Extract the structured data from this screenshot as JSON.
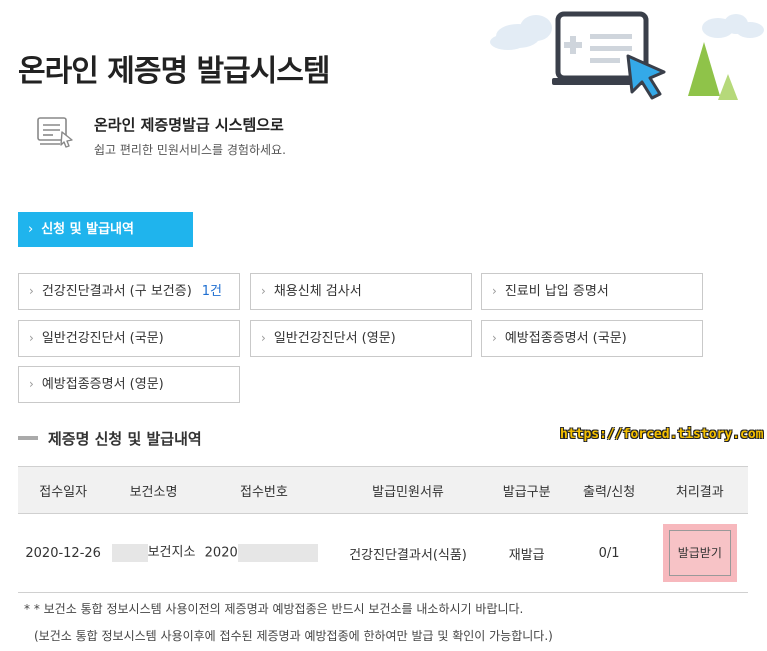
{
  "header": {
    "title": "온라인 제증명 발급시스템",
    "hero_title": "온라인 제증명발급 시스템으로",
    "hero_subtitle": "쉽고 편리한 민원서비스를 경험하세요."
  },
  "active_tab": {
    "label": "신청 및 발급내역",
    "color": "#1fb4ed"
  },
  "categories": [
    {
      "label": "건강진단결과서 (구 보건증)",
      "count": "1건"
    },
    {
      "label": "채용신체 검사서"
    },
    {
      "label": "진료비 납입 증명서"
    },
    {
      "label": "일반건강진단서 (국문)"
    },
    {
      "label": "일반건강진단서 (영문)"
    },
    {
      "label": "예방접종증명서 (국문)"
    },
    {
      "label": "예방접종증명서 (영문)"
    }
  ],
  "section": {
    "title": "제증명 신청 및 발급내역",
    "watermark": "https://forced.tistory.com"
  },
  "table": {
    "headers": [
      "접수일자",
      "보건소명",
      "접수번호",
      "발급민원서류",
      "발급구분",
      "출력/신청",
      "처리결과"
    ],
    "row": {
      "date": "2020-12-26",
      "clinic_suffix": "보건지소",
      "receipt_prefix": "2020",
      "document": "건강진단결과서(식품)",
      "issue_type": "재발급",
      "print_ratio": "0/1",
      "action_label": "발급받기"
    }
  },
  "notes": {
    "line1": "* * 보건소 통합 정보시스템 사용이전의 제증명과 예방접종은 반드시 보건소를 내소하시기 바랍니다.",
    "line2": "(보건소 통합 정보시스템 사용이후에 접수된 제증명과 예방접종에 한하여만 발급 및 확인이 가능합니다.)"
  }
}
